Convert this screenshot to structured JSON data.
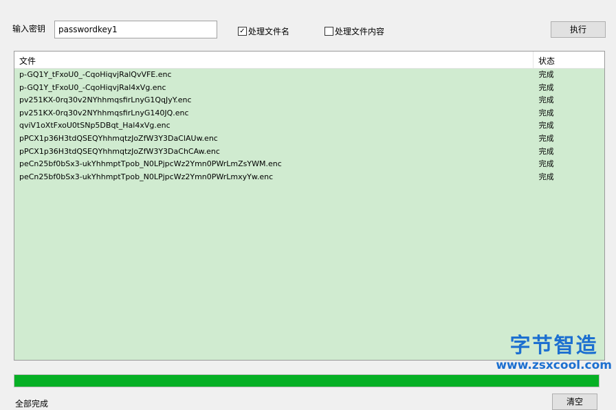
{
  "key_label": "输入密钥",
  "key_value": "passwordkey1",
  "opt_filename": {
    "label": "处理文件名",
    "checked": true
  },
  "opt_content": {
    "label": "处理文件内容",
    "checked": false
  },
  "run_button": "执行",
  "columns": [
    "文件",
    "状态"
  ],
  "rows": [
    {
      "file": "p-GQ1Y_tFxoU0_-CqoHiqvjRalQvVFE.enc",
      "status": "完成"
    },
    {
      "file": "p-GQ1Y_tFxoU0_-CqoHiqvjRal4xVg.enc",
      "status": "完成"
    },
    {
      "file": "pv251KX-0rq30v2NYhhmqsfirLnyG1QqJyY.enc",
      "status": "完成"
    },
    {
      "file": "pv251KX-0rq30v2NYhhmqsfirLnyG140JQ.enc",
      "status": "完成"
    },
    {
      "file": "qviV1oXtFxoU0tSNp5DBqt_Hal4xVg.enc",
      "status": "完成"
    },
    {
      "file": "pPCX1p36H3tdQSEQYhhmqtzJoZfW3Y3DaClAUw.enc",
      "status": "完成"
    },
    {
      "file": "pPCX1p36H3tdQSEQYhhmqtzJoZfW3Y3DaChCAw.enc",
      "status": "完成"
    },
    {
      "file": "peCn25bf0bSx3-ukYhhmptTpob_N0LPjpcWz2Ymn0PWrLmZsYWM.enc",
      "status": "完成"
    },
    {
      "file": "peCn25bf0bSx3-ukYhhmptTpob_N0LPjpcWz2Ymn0PWrLmxyYw.enc",
      "status": "完成"
    }
  ],
  "progress_percent": 100,
  "status_text": "全部完成",
  "clear_button": "清空",
  "watermark": {
    "title": "字节智造",
    "url": "www.zsxcool.com"
  }
}
